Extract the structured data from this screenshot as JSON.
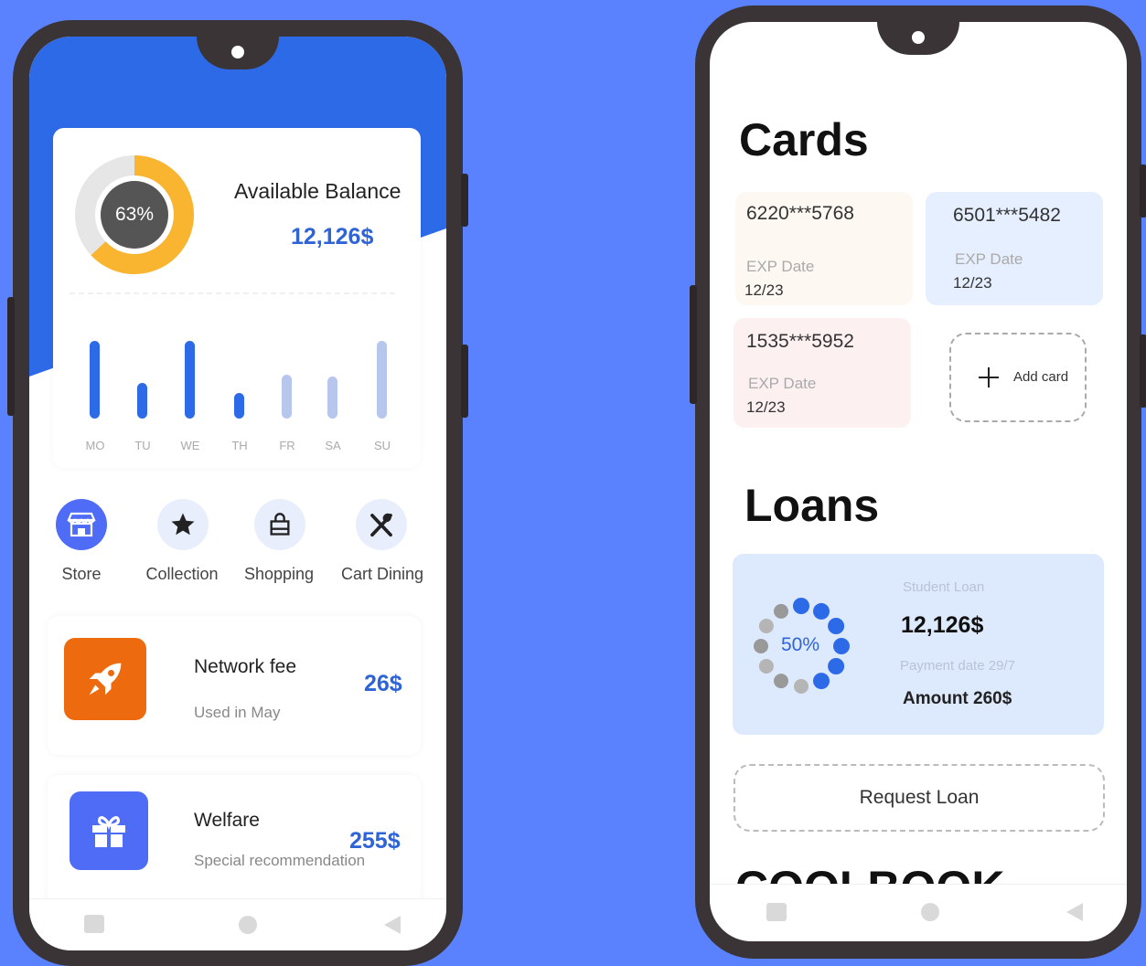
{
  "left_phone": {
    "balance": {
      "percent_label": "63%",
      "percent": 63,
      "label": "Available Balance",
      "value": "12,126$"
    },
    "weekly_chart": {
      "days": [
        "MO",
        "TU",
        "WE",
        "TH",
        "FR",
        "SA",
        "SU"
      ],
      "levels": [
        92,
        42,
        92,
        30,
        52,
        50,
        92
      ],
      "highlighted": [
        true,
        true,
        true,
        true,
        false,
        false,
        false
      ]
    },
    "shortcuts": [
      {
        "label": "Store",
        "icon": "store-icon"
      },
      {
        "label": "Collection",
        "icon": "star-icon"
      },
      {
        "label": "Shopping",
        "icon": "shopping-bag-icon"
      },
      {
        "label": "Cart Dining",
        "icon": "utensils-icon"
      }
    ],
    "transactions": [
      {
        "title": "Network fee",
        "subtitle": "Used in May",
        "amount": "26$",
        "icon": "rocket-icon",
        "color": "#ee6a0e"
      },
      {
        "title": "Welfare",
        "subtitle": "Special recommendation",
        "amount": "255$",
        "icon": "gift-icon",
        "color": "#4e6cf5"
      }
    ]
  },
  "right_phone": {
    "cards_title": "Cards",
    "cards": [
      {
        "number": "6220***5768",
        "exp_label": "EXP Date",
        "exp": "12/23",
        "color": "#fdf8f2"
      },
      {
        "number": "6501***5482",
        "exp_label": "EXP Date",
        "exp": "12/23",
        "color": "#e5efff"
      },
      {
        "number": "1535***5952",
        "exp_label": "EXP Date",
        "exp": "12/23",
        "color": "#fdf0f1"
      }
    ],
    "add_card_label": "Add card",
    "loans_title": "Loans",
    "loan": {
      "percent_label": "50%",
      "type": "Student Loan",
      "value": "12,126$",
      "payment_date": "Payment date 29/7",
      "amount": "Amount 260$"
    },
    "request_loan_label": "Request Loan",
    "next_section_title": "COOLBOOK"
  },
  "colors": {
    "background": "#5a82ff",
    "accent": "#2f64d6",
    "header_blue": "#2d6ae8",
    "donut_orange": "#f9b430"
  }
}
